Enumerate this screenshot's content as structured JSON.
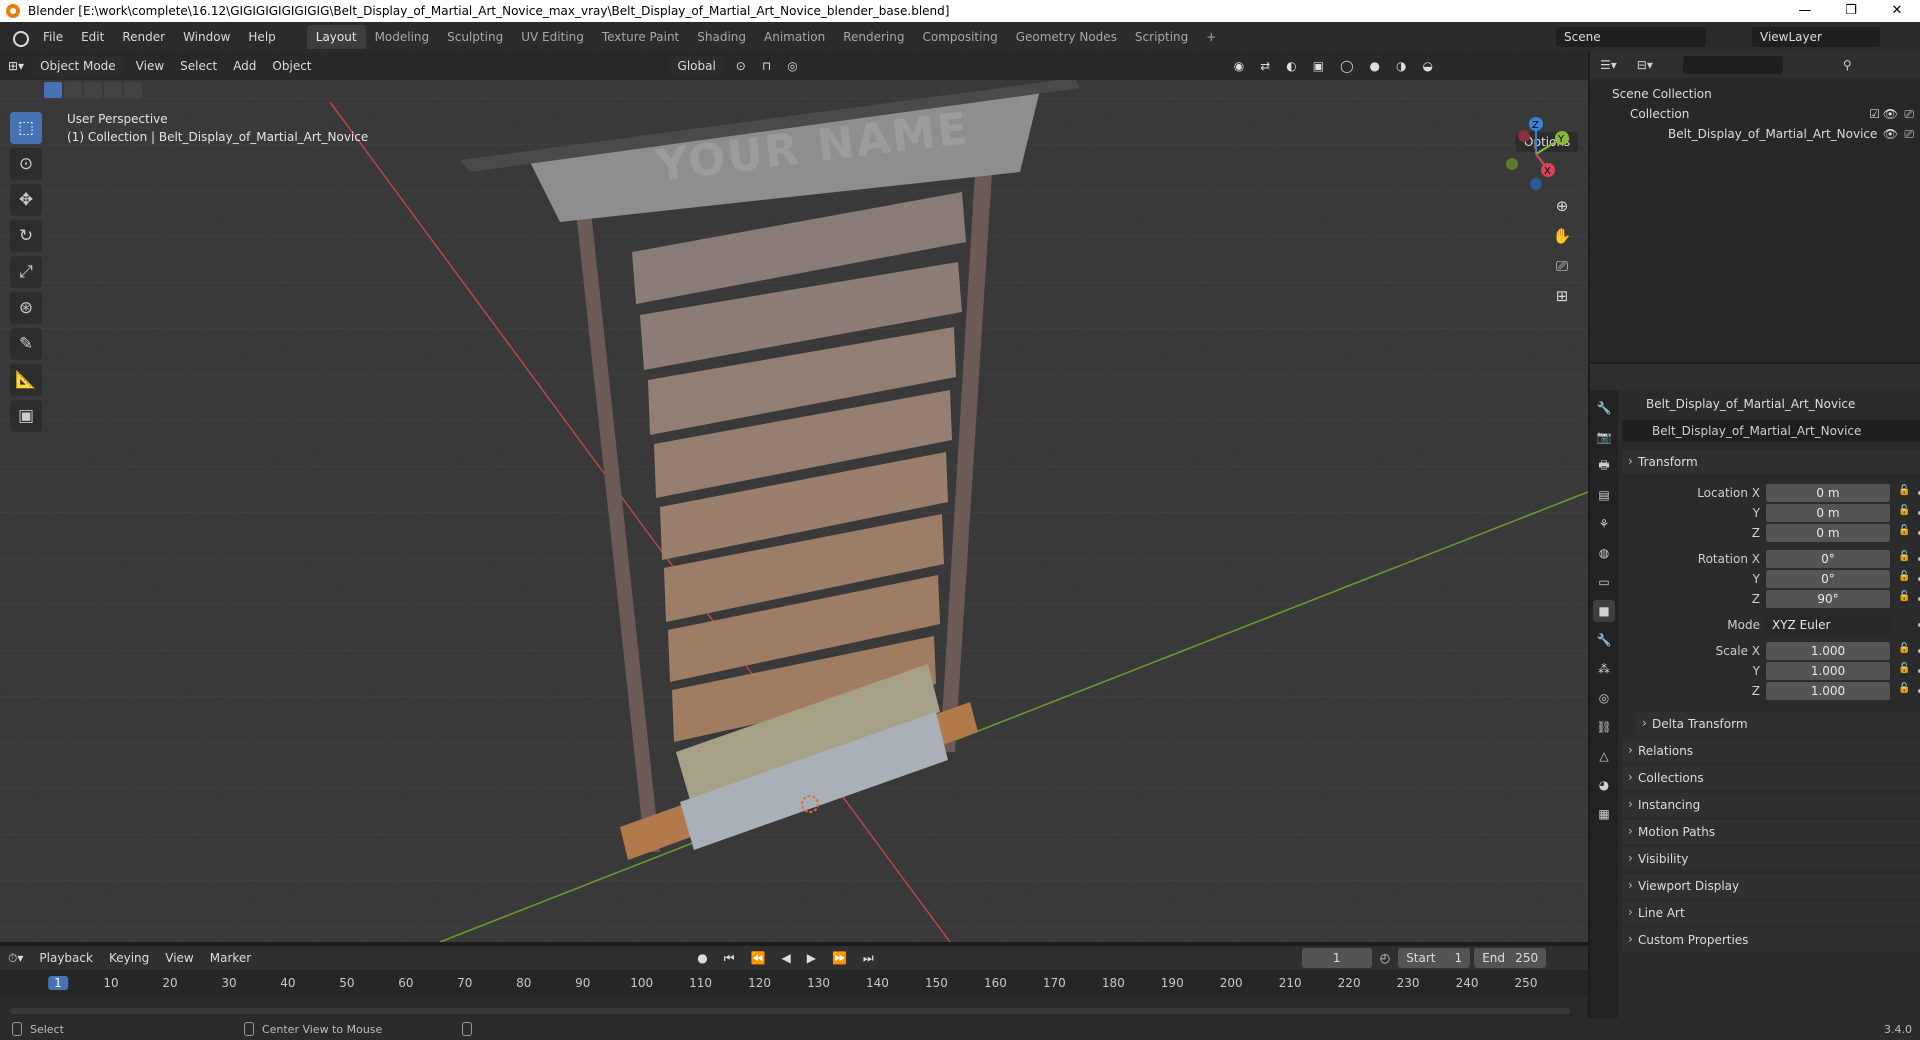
{
  "window": {
    "title": "Blender [E:\\work\\complete\\16.12\\GIGIGIGIGIGIGIG\\Belt_Display_of_Martial_Art_Novice_max_vray\\Belt_Display_of_Martial_Art_Novice_blender_base.blend]",
    "minimize": "—",
    "restore": "❐",
    "close": "✕"
  },
  "menus": [
    "File",
    "Edit",
    "Render",
    "Window",
    "Help"
  ],
  "workspaces": [
    "Layout",
    "Modeling",
    "Sculpting",
    "UV Editing",
    "Texture Paint",
    "Shading",
    "Animation",
    "Rendering",
    "Compositing",
    "Geometry Nodes",
    "Scripting"
  ],
  "add_workspace": "+",
  "scene": {
    "label": "Scene",
    "view_layer": "ViewLayer"
  },
  "viewport": {
    "mode": "Object Mode",
    "menus": [
      "View",
      "Select",
      "Add",
      "Object"
    ],
    "orientation": "Global",
    "options": "Options",
    "perspective": "User Perspective",
    "collection_line": "(1) Collection | Belt_Display_of_Martial_Art_Novice",
    "sign_text": "YOUR NAME",
    "gizmo": {
      "x": "X",
      "y": "Y",
      "z": "Z"
    }
  },
  "outliner": {
    "scene_collection": "Scene Collection",
    "collection": "Collection",
    "object": "Belt_Display_of_Martial_Art_Novice"
  },
  "properties": {
    "object_name": "Belt_Display_of_Martial_Art_Novice",
    "data_name": "Belt_Display_of_Martial_Art_Novice",
    "transform": "Transform",
    "location_label": "Location X",
    "rotation_label": "Rotation X",
    "scale_label": "Scale X",
    "y": "Y",
    "z": "Z",
    "location": [
      "0 m",
      "0 m",
      "0 m"
    ],
    "rotation": [
      "0°",
      "0°",
      "90°"
    ],
    "mode_label": "Mode",
    "mode_value": "XYZ Euler",
    "scale": [
      "1.000",
      "1.000",
      "1.000"
    ],
    "delta": "Delta Transform",
    "panels": [
      "Relations",
      "Collections",
      "Instancing",
      "Motion Paths",
      "Visibility",
      "Viewport Display",
      "Line Art",
      "Custom Properties"
    ]
  },
  "timeline": {
    "menus": [
      "Playback",
      "Keying",
      "View",
      "Marker"
    ],
    "current_frame": "1",
    "start_label": "Start",
    "start": "1",
    "end_label": "End",
    "end": "250",
    "ticks": [
      "1",
      "10",
      "20",
      "30",
      "40",
      "50",
      "60",
      "70",
      "80",
      "90",
      "100",
      "110",
      "120",
      "130",
      "140",
      "150",
      "160",
      "170",
      "180",
      "190",
      "200",
      "210",
      "220",
      "230",
      "240",
      "250"
    ]
  },
  "status": {
    "select": "Select",
    "center": "Center View to Mouse",
    "version": "3.4.0"
  }
}
